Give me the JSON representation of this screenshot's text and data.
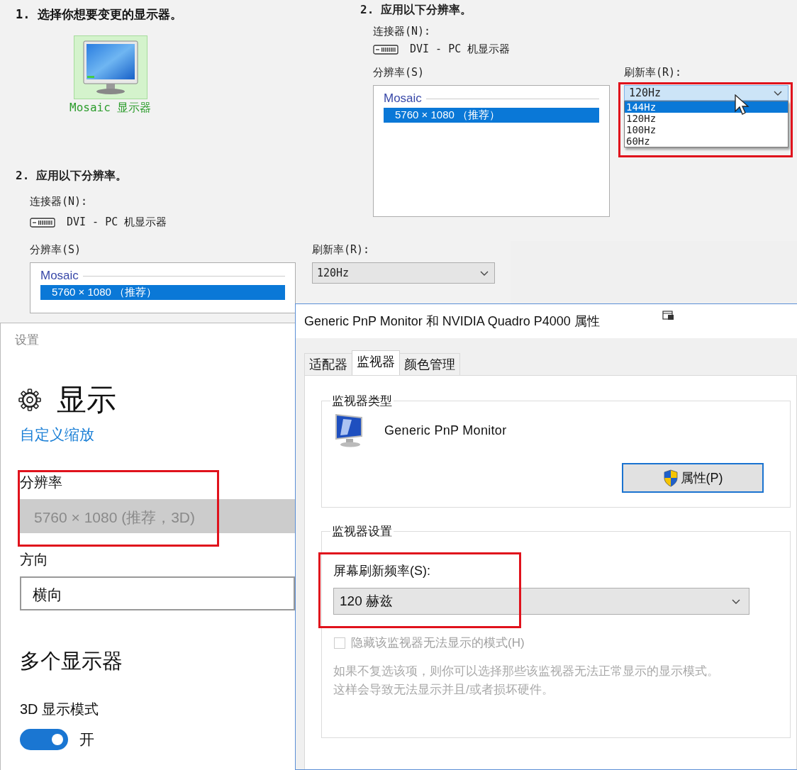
{
  "display_picker": {
    "heading": "1. 选择你想要变更的显示器。",
    "displays": [
      {
        "label": "Mosaic 显示器",
        "selected": true
      }
    ]
  },
  "resolution_panels": [
    {
      "heading": "2. 应用以下分辨率。",
      "connector_label": "连接器(N):",
      "connector": "DVI - PC 机显示器",
      "resolution_label": "分辨率(S)",
      "resolution_group": "Mosaic",
      "resolutions": [
        {
          "label": "5760 × 1080 （推荐）",
          "selected": true
        }
      ],
      "refresh_label": "刷新率(R):",
      "refresh_value": "120Hz",
      "expanded": true,
      "highlighted": true,
      "refresh_options": [
        {
          "label": "144Hz",
          "selected": true
        },
        {
          "label": "120Hz",
          "selected": false
        },
        {
          "label": "100Hz",
          "selected": false
        },
        {
          "label": "60Hz",
          "selected": false
        }
      ]
    },
    {
      "heading": "2. 应用以下分辨率。",
      "connector_label": "连接器(N):",
      "connector": "DVI - PC 机显示器",
      "resolution_label": "分辨率(S)",
      "resolution_group": "Mosaic",
      "resolutions": [
        {
          "label": "5760 × 1080 （推荐）",
          "selected": true
        }
      ],
      "refresh_label": "刷新率(R):",
      "refresh_value": "120Hz",
      "expanded": false
    }
  ],
  "settings": {
    "title": "设置",
    "heading": "显示",
    "link": "自定义缩放",
    "resolution_label": "分辨率",
    "resolution_value": "5760 × 1080 (推荐，3D)",
    "resolution_disabled": true,
    "highlighted": true,
    "orientation_label": "方向",
    "orientation_value": "横向",
    "section": "多个显示器",
    "mode_label": "3D 显示模式",
    "mode_on": true,
    "mode_state": "开"
  },
  "properties_dialog": {
    "title": "Generic PnP Monitor 和 NVIDIA Quadro P4000 属性",
    "tabs": [
      {
        "label": "适配器",
        "selected": false
      },
      {
        "label": "监视器",
        "selected": true
      },
      {
        "label": "颜色管理",
        "selected": false
      }
    ],
    "type_group": "监视器类型",
    "monitor_name": "Generic PnP Monitor",
    "properties_button": "属性(P)",
    "settings_group": "监视器设置",
    "refresh_label": "屏幕刷新频率(S):",
    "refresh_value": "120 赫兹",
    "highlighted": true,
    "hide_modes": {
      "label": "隐藏该监视器无法显示的模式(H)",
      "checked": false,
      "disabled": true
    },
    "note_lines": [
      "如果不复选该项，则你可以选择那些该监视器无法正常显示的显示模式。",
      "这样会导致无法显示并且/或者损坏硬件。"
    ]
  }
}
